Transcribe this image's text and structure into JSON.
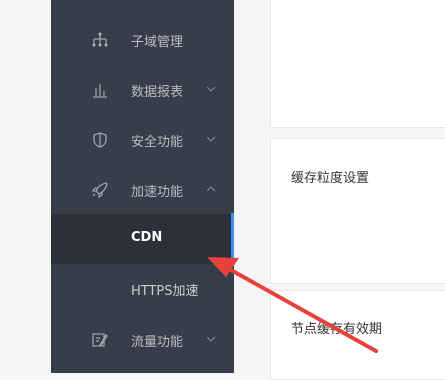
{
  "sidebar": {
    "items": [
      {
        "label": "子域管理",
        "icon": "hierarchy-icon",
        "has_chevron": false
      },
      {
        "label": "数据报表",
        "icon": "bar-chart-icon",
        "has_chevron": true,
        "chevron": "down"
      },
      {
        "label": "安全功能",
        "icon": "shield-icon",
        "has_chevron": true,
        "chevron": "down"
      },
      {
        "label": "加速功能",
        "icon": "rocket-icon",
        "has_chevron": true,
        "chevron": "up"
      },
      {
        "label": "流量功能",
        "icon": "edit-icon",
        "has_chevron": true,
        "chevron": "down"
      }
    ],
    "submenu": [
      {
        "label": "CDN",
        "active": true
      },
      {
        "label": "HTTPS加速",
        "active": false
      }
    ]
  },
  "main": {
    "cards": [
      {
        "title": ""
      },
      {
        "title": "缓存粒度设置"
      },
      {
        "title": "节点缓存有效期"
      }
    ]
  },
  "annotation": {
    "color": "#e8413b",
    "meaning": "red arrow pointing at CDN menu item"
  },
  "colors": {
    "sidebar_bg": "#373d49",
    "active_bg": "#2b3039",
    "accent": "#3e8ef7"
  }
}
